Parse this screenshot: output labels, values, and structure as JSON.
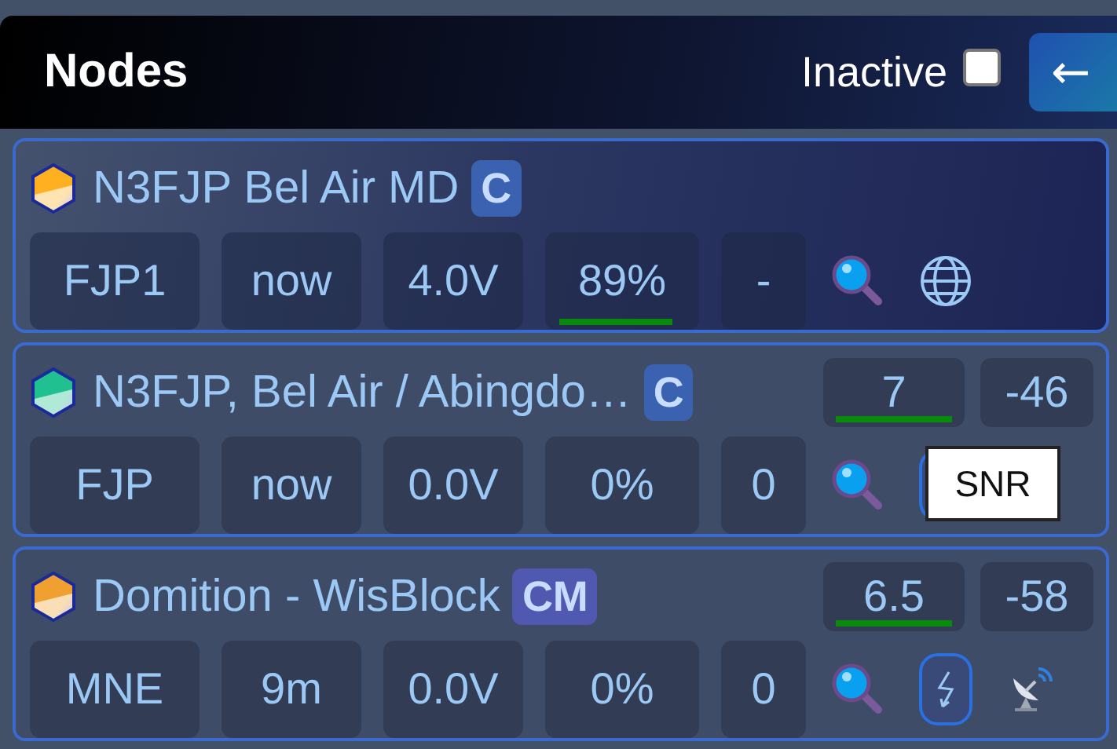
{
  "header": {
    "title": "Nodes",
    "inactive": {
      "label": "Inactive",
      "checked": false
    },
    "back_button": "←"
  },
  "nodes": [
    {
      "name": "N3FJP Bel Air MD",
      "selected": true,
      "color": "#ffb020",
      "badge": {
        "text": "C",
        "color": "#3b62b0"
      },
      "short": "FJP1",
      "heard": "now",
      "voltage": "4.0V",
      "battery": {
        "text": "89%",
        "underlined": true
      },
      "hops": "-",
      "actions": [
        {
          "kind": "search"
        },
        {
          "kind": "globe"
        }
      ]
    },
    {
      "name": "N3FJP, Bel Air / Abingdo…",
      "selected": false,
      "color": "#20c090",
      "badge": {
        "text": "C",
        "color": "#3b62b0"
      },
      "snr": {
        "text": "7",
        "underlined": true
      },
      "rssi": "-46",
      "short": "FJP",
      "heard": "now",
      "voltage": "0.0V",
      "battery": {
        "text": "0%"
      },
      "hops": "0",
      "actions": [
        {
          "kind": "search"
        },
        {
          "kind": "covered"
        }
      ]
    },
    {
      "name": "Domition - WisBlock",
      "selected": false,
      "color": "#f0a030",
      "badge": {
        "text": "CM",
        "color": "#5158b0"
      },
      "snr": {
        "text": "6.5",
        "underlined": true
      },
      "rssi": "-58",
      "short": "MNE",
      "heard": "9m",
      "voltage": "0.0V",
      "battery": {
        "text": "0%"
      },
      "hops": "0",
      "actions": [
        {
          "kind": "search"
        },
        {
          "kind": "bolt"
        },
        {
          "kind": "satellite"
        }
      ]
    }
  ],
  "tooltip": "SNR"
}
